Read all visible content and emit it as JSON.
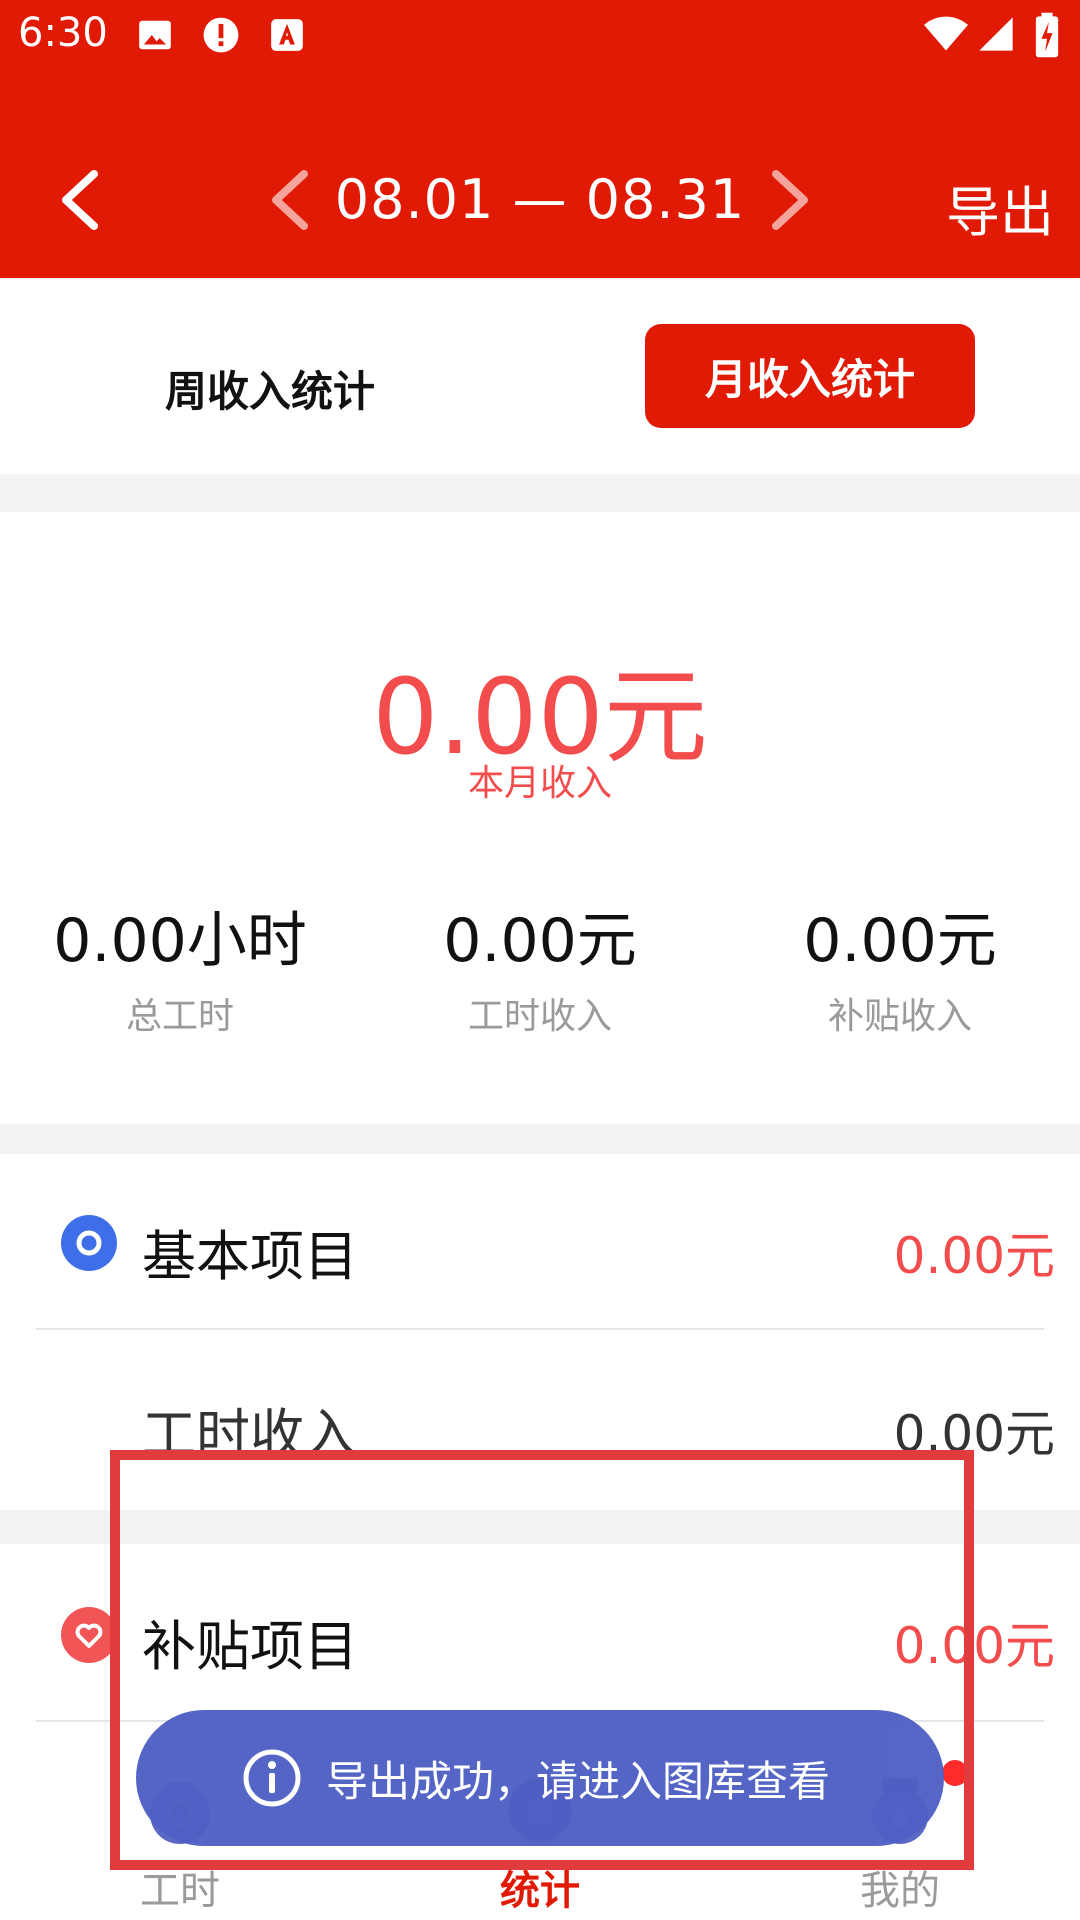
{
  "status_bar": {
    "time": "6:30"
  },
  "header": {
    "date_range": "08.01 — 08.31",
    "export_label": "导出",
    "bg_color": "#e11a05"
  },
  "tabs": {
    "week_label": "周收入统计",
    "month_label": "月收入统计",
    "selected": "月收入统计"
  },
  "summary": {
    "month_income_value": "0.00元",
    "month_income_label": "本月收入",
    "stats": [
      {
        "value": "0.00小时",
        "label": "总工时"
      },
      {
        "value": "0.00元",
        "label": "工时收入"
      },
      {
        "value": "0.00元",
        "label": "补贴收入"
      }
    ]
  },
  "basic": {
    "title": "基本项目",
    "value": "0.00元",
    "items": [
      {
        "label": "工时收入",
        "value": "0.00元"
      }
    ]
  },
  "subsidy": {
    "title": "补贴项目",
    "value": "0.00元"
  },
  "bottom_nav": {
    "items": [
      {
        "label": "工时",
        "icon": "money-bag-icon"
      },
      {
        "label": "统计",
        "icon": "stats-icon"
      },
      {
        "label": "我的",
        "icon": "profile-icon"
      }
    ],
    "active": "统计"
  },
  "toast": {
    "message": "导出成功，请进入图库查看",
    "icon": "info-icon"
  },
  "colors": {
    "accent_red": "#e11a05",
    "value_red": "#f24c4c",
    "toast_bg": "#4f5fc4",
    "blue_dot": "#3e6ee8"
  }
}
